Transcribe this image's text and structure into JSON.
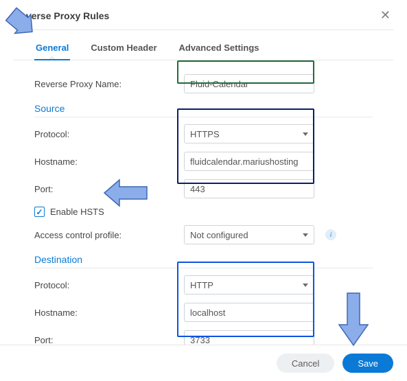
{
  "dialog": {
    "title": "Reverse Proxy Rules"
  },
  "tabs": {
    "general": "General",
    "custom_header": "Custom Header",
    "advanced": "Advanced Settings"
  },
  "fields": {
    "name_label": "Reverse Proxy Name:",
    "name_value": "Fluid-Calendar",
    "source_title": "Source",
    "src_proto_label": "Protocol:",
    "src_proto_value": "HTTPS",
    "src_host_label": "Hostname:",
    "src_host_value": "fluidcalendar.mariushosting",
    "src_port_label": "Port:",
    "src_port_value": "443",
    "hsts_label": "Enable HSTS",
    "acp_label": "Access control profile:",
    "acp_value": "Not configured",
    "dest_title": "Destination",
    "dst_proto_label": "Protocol:",
    "dst_proto_value": "HTTP",
    "dst_host_label": "Hostname:",
    "dst_host_value": "localhost",
    "dst_port_label": "Port:",
    "dst_port_value": "3733"
  },
  "buttons": {
    "cancel": "Cancel",
    "save": "Save"
  }
}
